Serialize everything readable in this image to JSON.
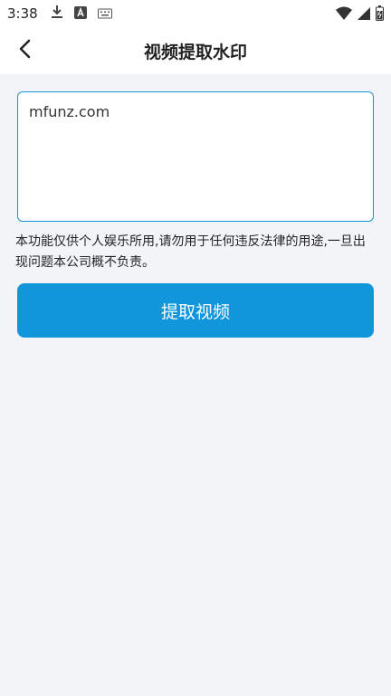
{
  "status_bar": {
    "time": "3:38",
    "icons_left": [
      "download-icon",
      "font-app-icon",
      "keyboard-icon"
    ],
    "icons_right": [
      "wifi-icon",
      "cellular-signal-icon",
      "battery-icon"
    ]
  },
  "header": {
    "title": "视频提取水印",
    "back_icon": "back-chevron-icon"
  },
  "form": {
    "url_value": "mfunz.com",
    "disclaimer": "本功能仅供个人娱乐所用,请勿用于任何违反法律的用途,一旦出现问题本公司概不负责。",
    "button_label": "提取视频"
  },
  "colors": {
    "accent": "#1296db",
    "background": "#f2f4f8",
    "header_bg": "#ffffff"
  }
}
